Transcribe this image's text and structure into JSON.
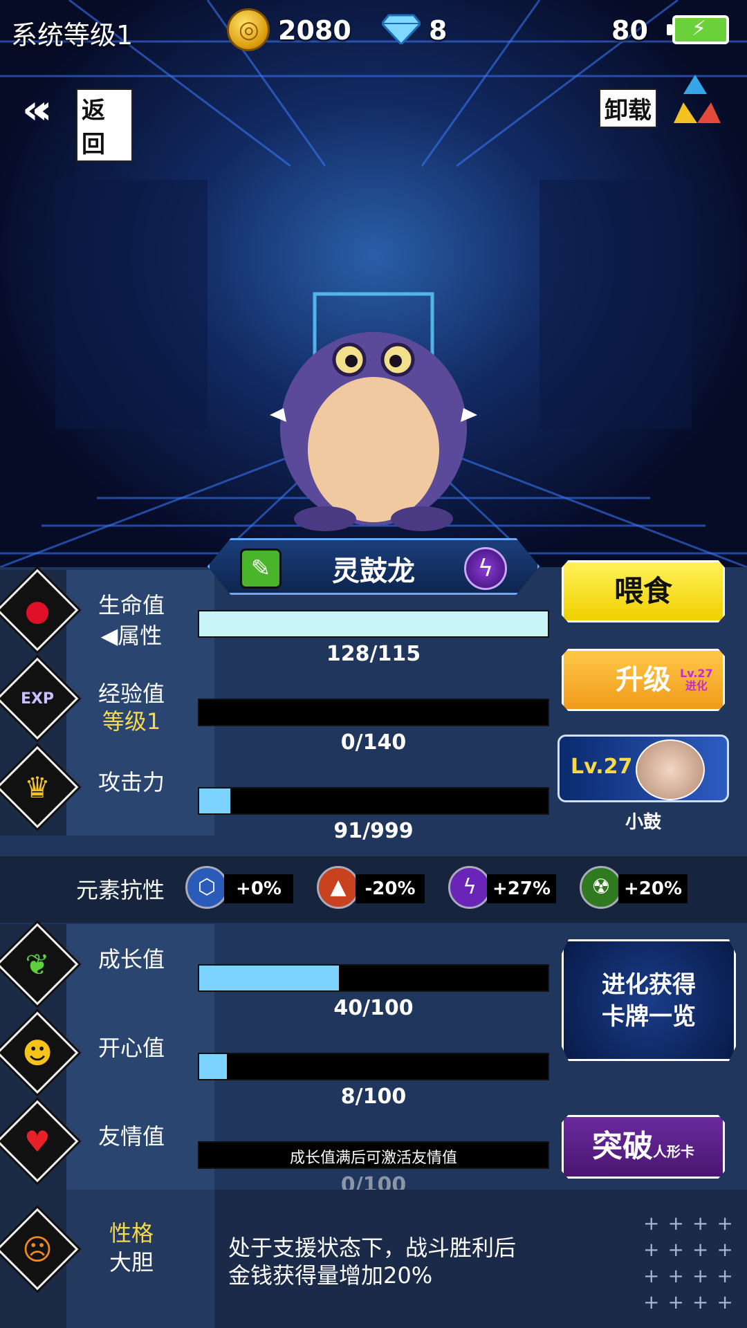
{
  "hud": {
    "system_level": "系统等级1",
    "coins": "2080",
    "gems": "8",
    "stamina": "80"
  },
  "nav": {
    "back": "返回",
    "unload": "卸载"
  },
  "pet": {
    "name": "灵鼓龙"
  },
  "stats": {
    "hp": {
      "label": "生命值",
      "sub": "◀属性",
      "value": "128/115",
      "fill": 1.0
    },
    "exp": {
      "label": "经验值",
      "sub": "等级1",
      "value": "0/140",
      "fill": 0.0
    },
    "atk": {
      "label": "攻击力",
      "value": "91/999",
      "fill": 0.09
    },
    "growth": {
      "label": "成长值",
      "value": "40/100",
      "fill": 0.4
    },
    "happy": {
      "label": "开心值",
      "value": "8/100",
      "fill": 0.08
    },
    "friend": {
      "label": "友情值",
      "bar_text": "成长值满后可激活友情值",
      "value": "0/100",
      "fill": 0.0
    }
  },
  "resist": {
    "title": "元素抗性",
    "items": [
      {
        "icon": "shield-element-icon",
        "value": "+0%",
        "color": "#2a5bb8"
      },
      {
        "icon": "fire-element-icon",
        "value": "-20%",
        "color": "#c8421f"
      },
      {
        "icon": "lightning-element-icon",
        "value": "+27%",
        "color": "#6b24b8"
      },
      {
        "icon": "poison-element-icon",
        "value": "+20%",
        "color": "#2f7a1f"
      }
    ]
  },
  "buttons": {
    "feed": "喂食",
    "upgrade": "升级",
    "upgrade_mini_1": "Lv.27",
    "upgrade_mini_2": "进化",
    "card_level": "Lv.27",
    "card_name": "小鼓",
    "evo_1": "进化获得",
    "evo_2": "卡牌一览",
    "breakthrough": "突破",
    "breakthrough_mini": "人形卡"
  },
  "trait": {
    "label": "性格",
    "value": "大胆",
    "desc_1": "处于支援状态下，战斗胜利后",
    "desc_2": "金钱获得量增加20%"
  }
}
